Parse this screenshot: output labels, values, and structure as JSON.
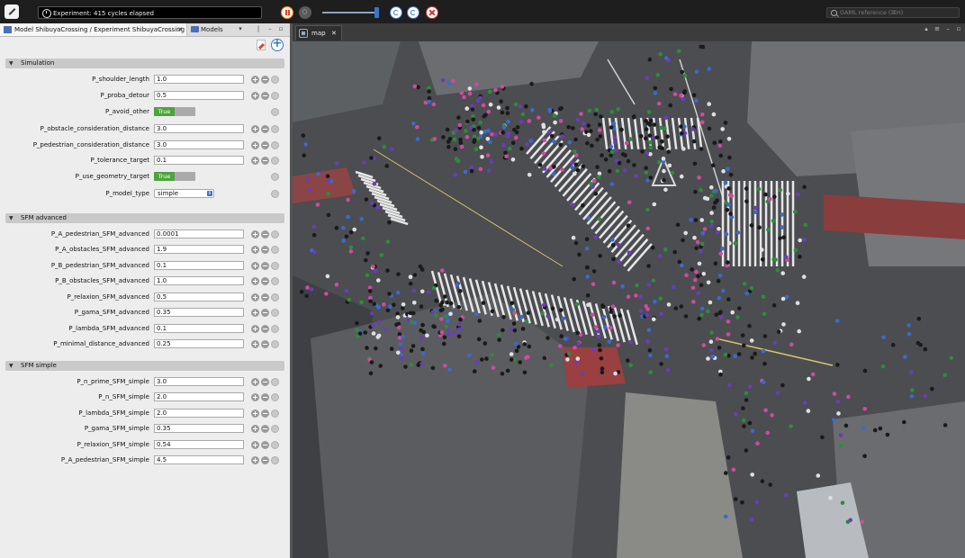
{
  "toolbar": {
    "status_text": "Experiment: 415 cycles elapsed",
    "search_placeholder": "GAML reference (⌘H)"
  },
  "left_panel": {
    "tabs": [
      {
        "label": "Model ShibuyaCrossing / Experiment ShibuyaCrossing",
        "close": "✕"
      },
      {
        "label": "Models"
      }
    ],
    "sections": [
      {
        "title": "Simulation",
        "params": [
          {
            "label": "P_shoulder_length",
            "type": "number",
            "value": "1.0"
          },
          {
            "label": "P_proba_detour",
            "type": "number",
            "value": "0.5"
          },
          {
            "label": "P_avoid_other",
            "type": "bool",
            "value": "True"
          },
          {
            "label": "P_obstacle_consideration_distance",
            "type": "number",
            "value": "3.0"
          },
          {
            "label": "P_pedestrian_consideration_distance",
            "type": "number",
            "value": "3.0"
          },
          {
            "label": "P_tolerance_target",
            "type": "number",
            "value": "0.1"
          },
          {
            "label": "P_use_geometry_target",
            "type": "bool",
            "value": "True"
          },
          {
            "label": "P_model_type",
            "type": "select",
            "value": "simple"
          }
        ]
      },
      {
        "title": "SFM advanced",
        "params": [
          {
            "label": "P_A_pedestrian_SFM_advanced",
            "type": "number",
            "value": "0.0001"
          },
          {
            "label": "P_A_obstacles_SFM_advanced",
            "type": "number",
            "value": "1.9"
          },
          {
            "label": "P_B_pedestrian_SFM_advanced",
            "type": "number",
            "value": "0.1"
          },
          {
            "label": "P_B_obstacles_SFM_advanced",
            "type": "number",
            "value": "1.0"
          },
          {
            "label": "P_relaxion_SFM_advanced",
            "type": "number",
            "value": "0.5"
          },
          {
            "label": "P_gama_SFM_advanced",
            "type": "number",
            "value": "0.35"
          },
          {
            "label": "P_lambda_SFM_advanced",
            "type": "number",
            "value": "0.1"
          },
          {
            "label": "P_minimal_distance_advanced",
            "type": "number",
            "value": "0.25"
          }
        ]
      },
      {
        "title": "SFM simple",
        "params": [
          {
            "label": "P_n_prime_SFM_simple",
            "type": "number",
            "value": "3.0"
          },
          {
            "label": "P_n_SFM_simple",
            "type": "number",
            "value": "2.0"
          },
          {
            "label": "P_lambda_SFM_simple",
            "type": "number",
            "value": "2.0"
          },
          {
            "label": "P_gama_SFM_simple",
            "type": "number",
            "value": "0.35"
          },
          {
            "label": "P_relaxion_SFM_simple",
            "type": "number",
            "value": "0.54"
          },
          {
            "label": "P_A_pedestrian_SFM_simple",
            "type": "number",
            "value": "4.5"
          }
        ]
      }
    ]
  },
  "right_panel": {
    "tab_label": "map",
    "tab_close": "✕"
  },
  "icons": {
    "experiment_tab": "experiment-icon",
    "models_tab": "folder-icon",
    "section_toggle": "chevron-down-icon",
    "param_buttons": [
      "increment-icon",
      "decrement-icon",
      "reset-icon"
    ]
  },
  "colors": {
    "toggle_on": "#4ea43c",
    "accent": "#3b74c6",
    "stop": "#cc3333"
  }
}
